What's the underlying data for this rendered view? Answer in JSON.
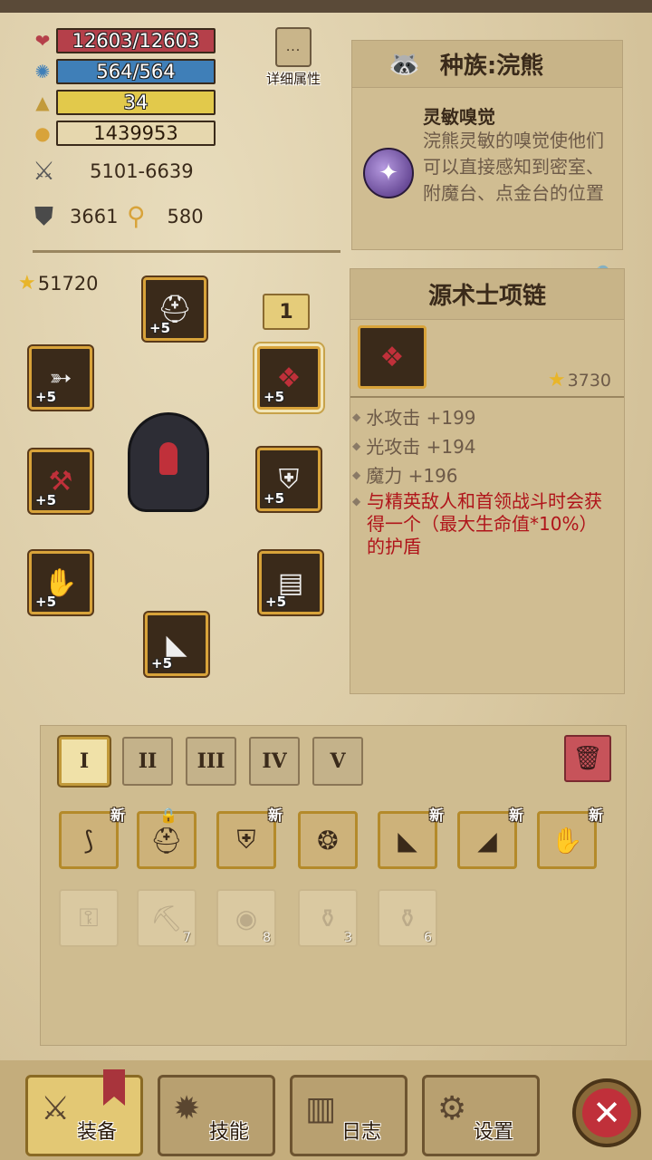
{
  "stats": {
    "hp": "12603/12603",
    "mp": "564/564",
    "level": "34",
    "gold": "1439953",
    "attack": "5101-6639",
    "defense": "3661",
    "magic": "580"
  },
  "detail_button": {
    "label": "详细属性",
    "icon": "..."
  },
  "race": {
    "title": "种族:浣熊",
    "trait_name": "灵敏嗅觉",
    "trait_desc": "浣熊灵敏的嗅觉使他们可以直接感知到密室、附魔台、点金台的位置"
  },
  "equipment": {
    "power": "51720",
    "loadout_tag": "1",
    "plus_label": "+5"
  },
  "item": {
    "title": "源术士项链",
    "value": "3730",
    "attributes": [
      "水攻击 +199",
      "光攻击 +194",
      "魔力 +196"
    ],
    "special": "与精英敌人和首领战斗时会获得一个（最大生命值*10%）的护盾"
  },
  "inventory": {
    "tabs": [
      "I",
      "II",
      "III",
      "IV",
      "V"
    ],
    "new_label": "新",
    "counts": [
      "7",
      "8",
      "3",
      "6"
    ]
  },
  "nav": {
    "equip": "装备",
    "skills": "技能",
    "log": "日志",
    "settings": "设置"
  },
  "colors": {
    "hp": "#b5404a",
    "mp": "#3f7fb8",
    "level": "#e2c94b",
    "frame": "#d8a33a",
    "special_text": "#b0141a"
  }
}
